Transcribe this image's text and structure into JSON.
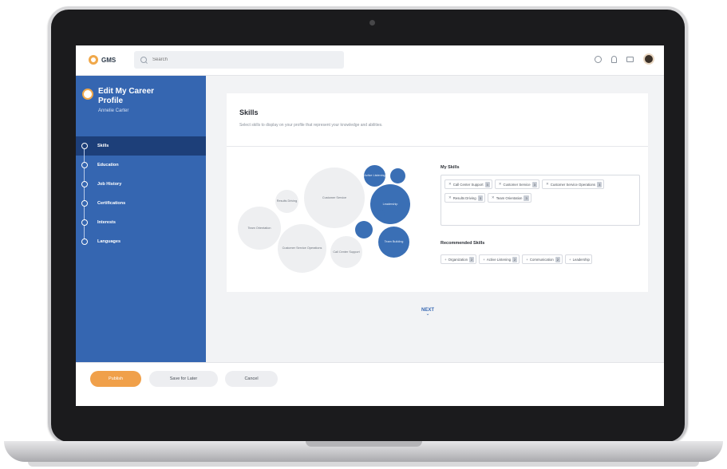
{
  "app": {
    "logo_text": "GMS"
  },
  "search": {
    "placeholder": "Search"
  },
  "icons": [
    "globe-icon",
    "bell-icon",
    "mail-icon",
    "user-avatar"
  ],
  "sidebar": {
    "title": "Edit My Career Profile",
    "user_name": "Annelie Carter",
    "steps": [
      {
        "label": "Skills",
        "active": true
      },
      {
        "label": "Education",
        "active": false
      },
      {
        "label": "Job History",
        "active": false
      },
      {
        "label": "Certifications",
        "active": false
      },
      {
        "label": "Interests",
        "active": false
      },
      {
        "label": "Languages",
        "active": false
      }
    ]
  },
  "card": {
    "title": "Skills",
    "subtitle": "Select skills to display on your profile that represent your knowledge and abilities."
  },
  "bubbles": [
    {
      "label": "Customer Service",
      "color": "grey"
    },
    {
      "label": "Results Driving",
      "color": "grey"
    },
    {
      "label": "Team Orientation",
      "color": "grey"
    },
    {
      "label": "Customer Service Operations",
      "color": "grey"
    },
    {
      "label": "Call Center Support",
      "color": "grey"
    },
    {
      "label": "Leadership",
      "color": "blue"
    },
    {
      "label": "Team Building",
      "color": "blue"
    },
    {
      "label": "Active Listening",
      "color": "blue"
    },
    {
      "label": "",
      "color": "blue"
    },
    {
      "label": "",
      "color": "blue"
    },
    {
      "label": "",
      "color": "blue"
    }
  ],
  "my_skills": {
    "label": "My Skills",
    "items": [
      {
        "name": "Call Center Support",
        "count": "3"
      },
      {
        "name": "Customer Service",
        "count": "3"
      },
      {
        "name": "Customer Service Operations",
        "count": "3"
      },
      {
        "name": "Results Driving",
        "count": "3"
      },
      {
        "name": "Team Orientation",
        "count": "3"
      }
    ]
  },
  "recommended": {
    "label": "Recommended Skills",
    "items": [
      {
        "name": "Organization",
        "count": "2"
      },
      {
        "name": "Active Listening",
        "count": "2"
      },
      {
        "name": "Communication",
        "count": "2"
      },
      {
        "name": "Leadership",
        "count": ""
      }
    ]
  },
  "next": {
    "label": "NEXT"
  },
  "buttons": {
    "primary": "Publish",
    "save_later": "Save for Later",
    "cancel": "Cancel"
  },
  "colors": {
    "sidebar": "#3566b1",
    "sidebar_active": "#1d3f79",
    "accent_orange": "#f0a04a",
    "bubble_blue": "#3a6fb5"
  }
}
